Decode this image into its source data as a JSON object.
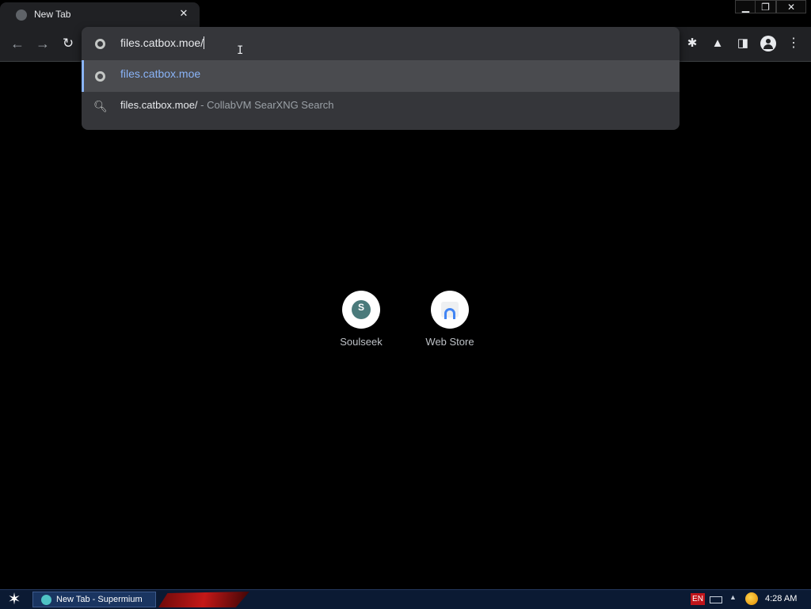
{
  "browser": {
    "tab": {
      "title": "New Tab",
      "close_label": "✕",
      "icon": "globe-icon"
    },
    "window_controls": {
      "minimize": "▁",
      "restore": "❐",
      "close": "✕"
    },
    "toolbar": {
      "back": "←",
      "forward": "→",
      "reload": "↻",
      "extensions": "✱",
      "labs": "▲",
      "side_panel": "◨",
      "menu": "⋮"
    },
    "omnibox": {
      "value": "files.catbox.moe/",
      "suggestions": [
        {
          "icon": "globe-icon",
          "text": "files.catbox.moe",
          "selected": true
        },
        {
          "icon": "search-icon",
          "text": "files.catbox.moe/",
          "description": " - CollabVM SearXNG Search"
        }
      ]
    }
  },
  "shortcuts": [
    {
      "label": "Soulseek",
      "initial": "S"
    },
    {
      "label": "Web Store"
    }
  ],
  "taskbar": {
    "task_label": "New Tab - Supermium",
    "language": "EN",
    "clock": "4:28 AM"
  },
  "colors": {
    "accent": "#8ab4f8",
    "omnibox_bg": "#35363a",
    "toolbar_bg": "#202124"
  }
}
